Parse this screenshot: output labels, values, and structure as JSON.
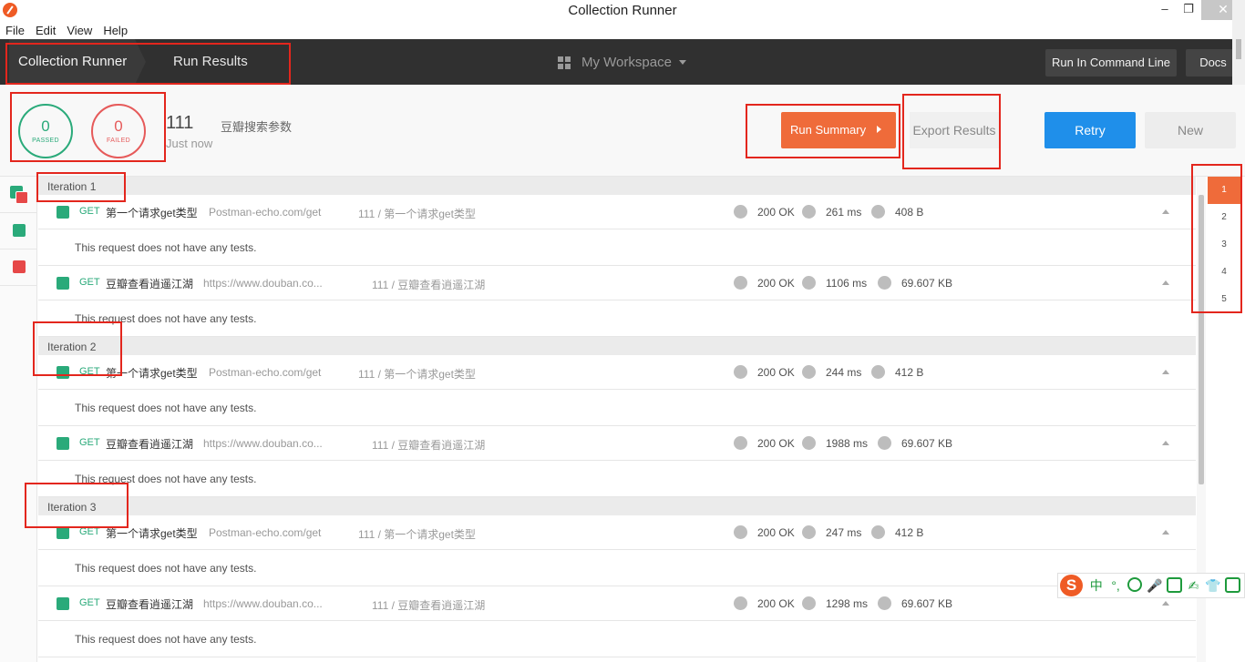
{
  "window": {
    "title": "Collection Runner",
    "controls": {
      "minimize": "–",
      "maximize": "❐",
      "close": "✕"
    }
  },
  "menu": [
    "File",
    "Edit",
    "View",
    "Help"
  ],
  "header": {
    "tabs": [
      "Collection Runner",
      "Run Results"
    ],
    "workspace": "My Workspace",
    "run_cli": "Run In Command Line",
    "docs": "Docs"
  },
  "summary": {
    "passed_count": "0",
    "passed_label": "PASSED",
    "failed_count": "0",
    "failed_label": "FAILED",
    "run_name": "111",
    "run_time": "Just now",
    "collection": "豆瓣搜索参数",
    "run_summary": "Run Summary",
    "export_results": "Export Results",
    "retry": "Retry",
    "new": "New"
  },
  "colors": {
    "pass": "#2aaa7a",
    "fail": "#e64848",
    "accent": "#ef6b3a",
    "primary": "#1f8fea"
  },
  "iterations": [
    {
      "label": "Iteration 1",
      "requests": [
        {
          "method": "GET",
          "name": "第一个请求get类型",
          "url": "Postman-echo.com/get",
          "path": "111 / 第一个请求get类型",
          "status": "200 OK",
          "time": "261 ms",
          "size": "408 B",
          "tests": "This request does not have any tests."
        },
        {
          "method": "GET",
          "name": "豆瓣查看逍遥江湖",
          "url": "https://www.douban.co...",
          "path": "111 / 豆瓣查看逍遥江湖",
          "status": "200 OK",
          "time": "1106 ms",
          "size": "69.607 KB",
          "tests": "This request does not have any tests."
        }
      ]
    },
    {
      "label": "Iteration 2",
      "requests": [
        {
          "method": "GET",
          "name": "第一个请求get类型",
          "url": "Postman-echo.com/get",
          "path": "111 / 第一个请求get类型",
          "status": "200 OK",
          "time": "244 ms",
          "size": "412 B",
          "tests": "This request does not have any tests."
        },
        {
          "method": "GET",
          "name": "豆瓣查看逍遥江湖",
          "url": "https://www.douban.co...",
          "path": "111 / 豆瓣查看逍遥江湖",
          "status": "200 OK",
          "time": "1988 ms",
          "size": "69.607 KB",
          "tests": "This request does not have any tests."
        }
      ]
    },
    {
      "label": "Iteration 3",
      "requests": [
        {
          "method": "GET",
          "name": "第一个请求get类型",
          "url": "Postman-echo.com/get",
          "path": "111 / 第一个请求get类型",
          "status": "200 OK",
          "time": "247 ms",
          "size": "412 B",
          "tests": "This request does not have any tests."
        },
        {
          "method": "GET",
          "name": "豆瓣查看逍遥江湖",
          "url": "https://www.douban.co...",
          "path": "111 / 豆瓣查看逍遥江湖",
          "status": "200 OK",
          "time": "1298 ms",
          "size": "69.607 KB",
          "tests": "This request does not have any tests."
        }
      ]
    }
  ],
  "pager": [
    "1",
    "2",
    "3",
    "4",
    "5"
  ],
  "pager_active": "1",
  "ime": {
    "logo": "S",
    "mode": "中",
    "punct": "°,",
    "icons": [
      "emoji-icon",
      "microphone-icon",
      "keyboard-icon",
      "handwriting-icon",
      "skin-icon",
      "toolbox-icon"
    ]
  }
}
